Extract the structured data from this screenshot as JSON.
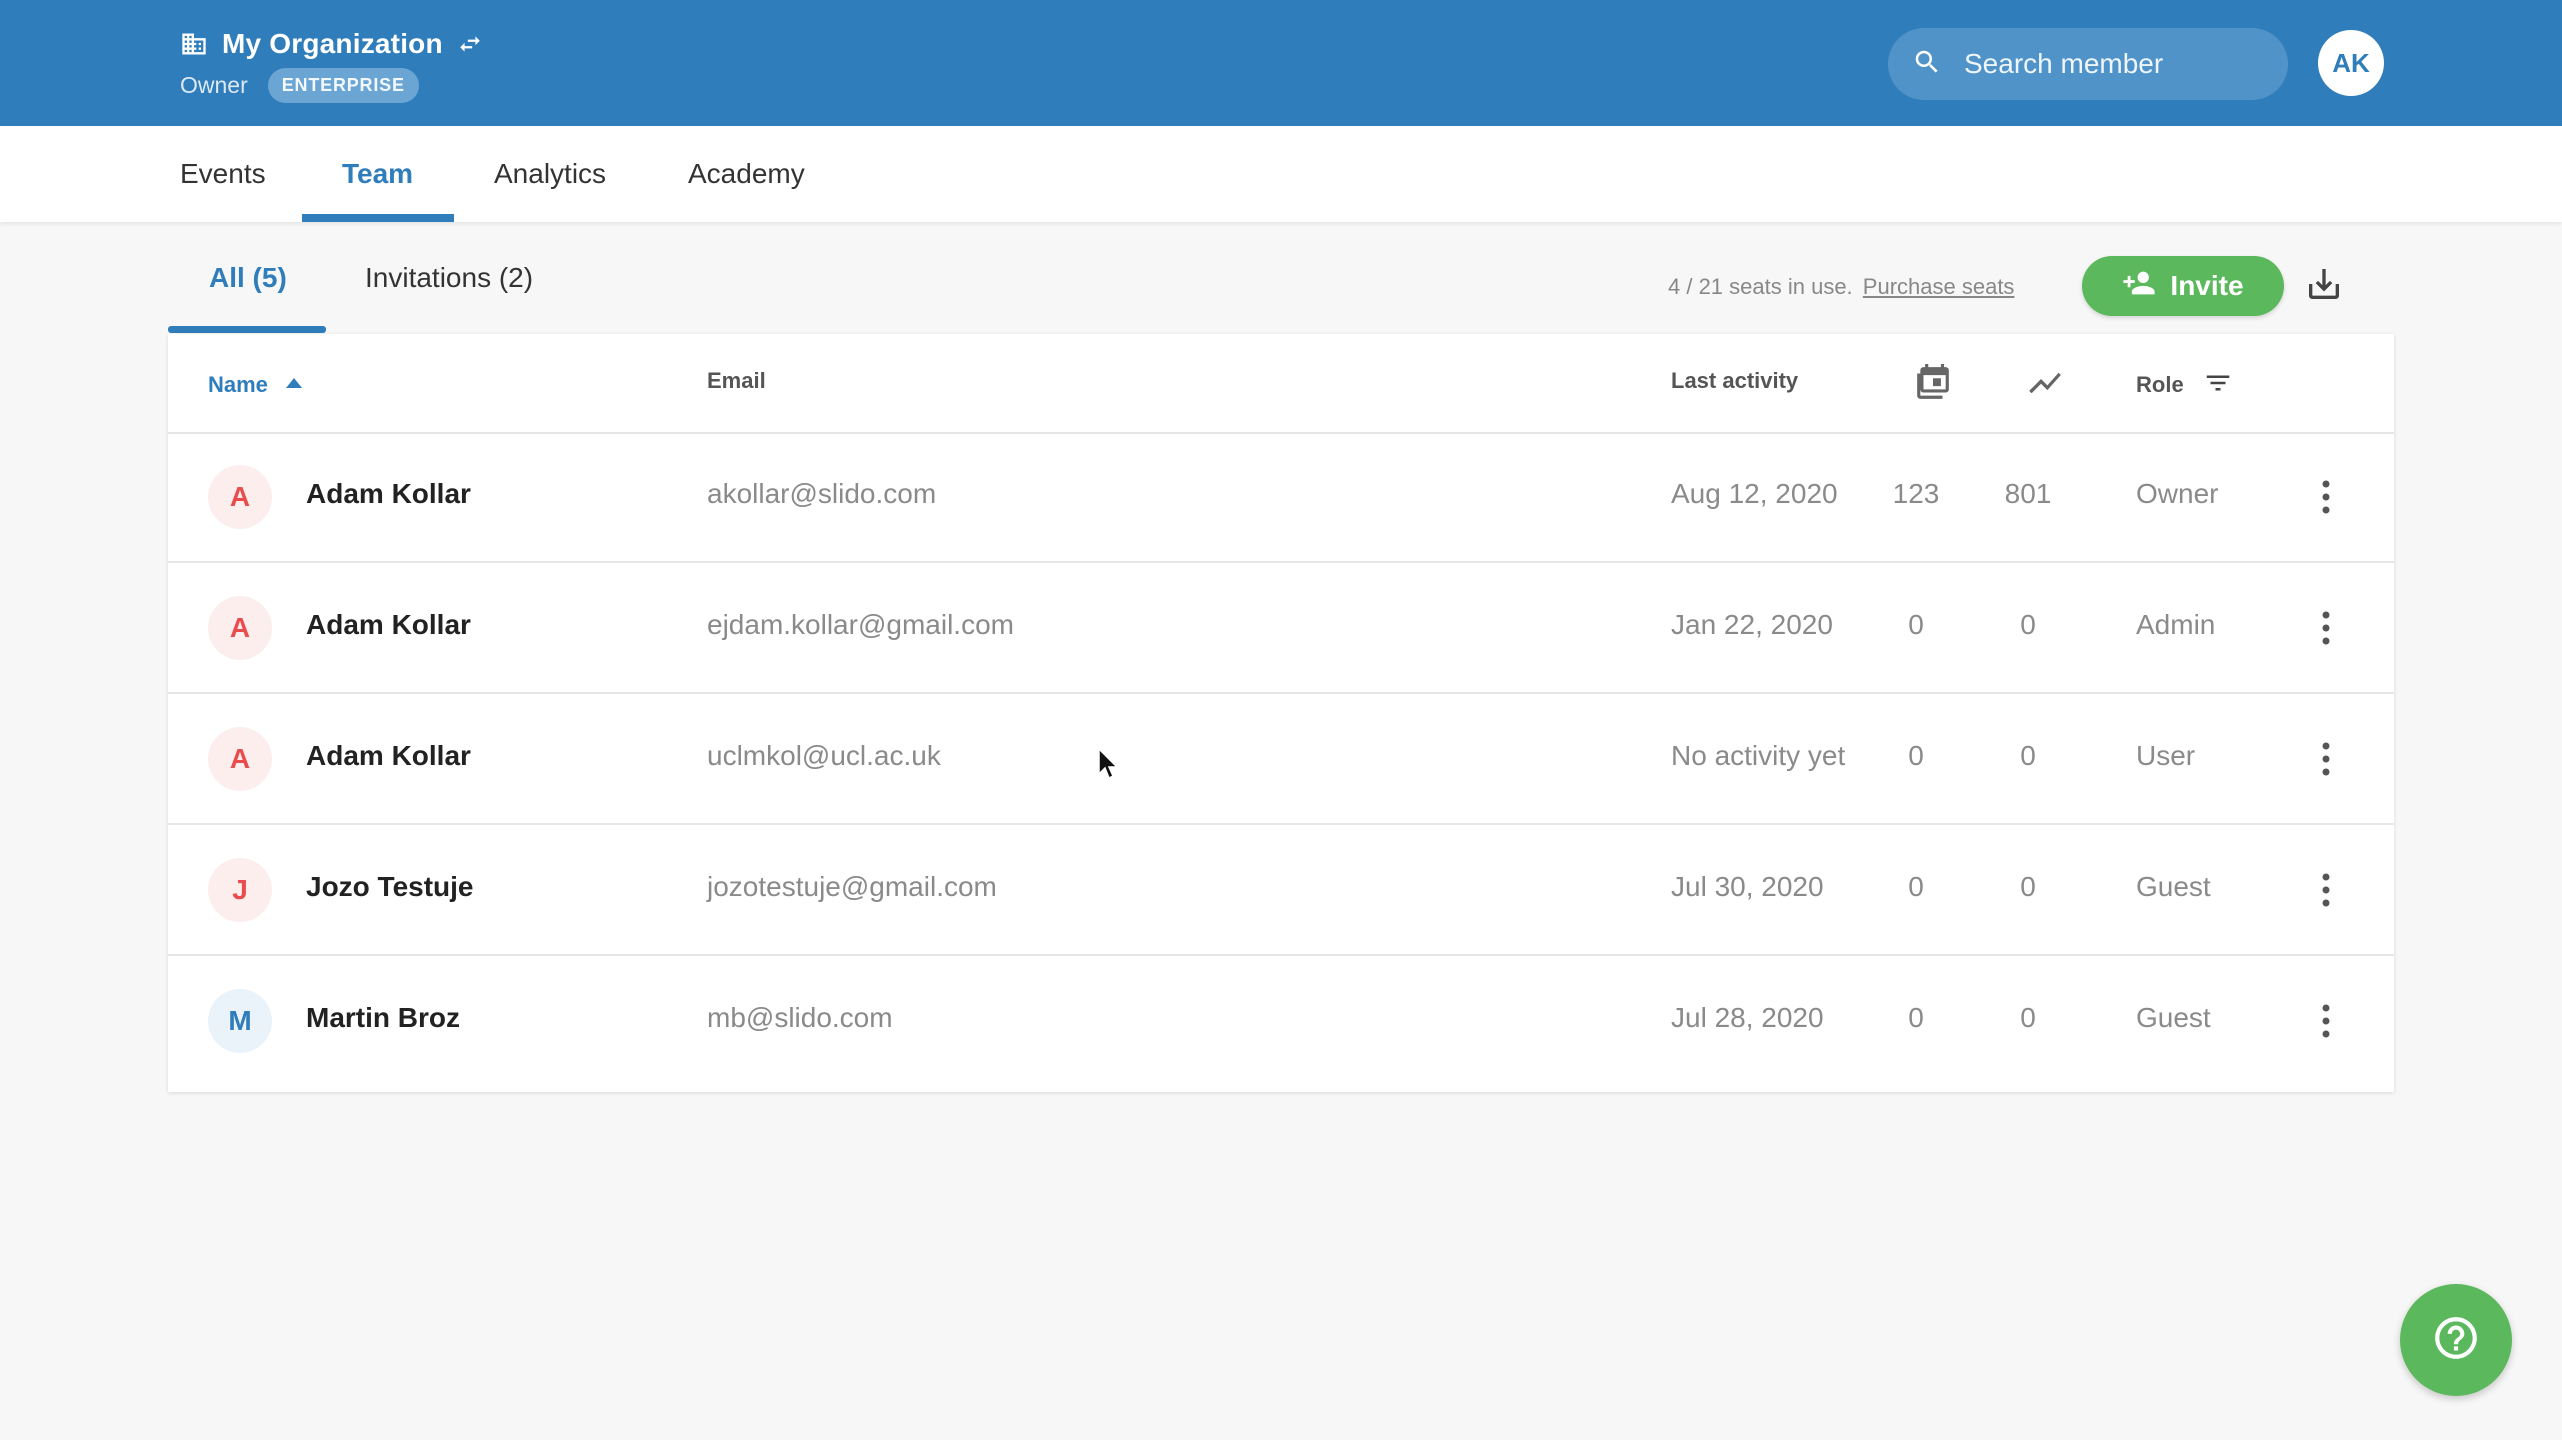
{
  "header": {
    "org_name": "My Organization",
    "role_label": "Owner",
    "plan_badge": "ENTERPRISE",
    "search_placeholder": "Search member",
    "user_initials": "AK"
  },
  "nav": {
    "tabs": [
      {
        "label": "Events"
      },
      {
        "label": "Team",
        "active": true
      },
      {
        "label": "Analytics"
      },
      {
        "label": "Academy"
      }
    ]
  },
  "team": {
    "subtabs": [
      {
        "label": "All (5)",
        "active": true
      },
      {
        "label": "Invitations (2)"
      }
    ],
    "seats_text": "4 / 21 seats in use.",
    "purchase_link": "Purchase seats",
    "invite_label": "Invite"
  },
  "table": {
    "columns": {
      "name": "Name",
      "email": "Email",
      "last_activity": "Last activity",
      "role": "Role"
    },
    "sort": {
      "column": "name",
      "direction": "asc"
    },
    "rows": [
      {
        "initial": "A",
        "name": "Adam Kollar",
        "email": "akollar@slido.com",
        "last_activity": "Aug 12, 2020",
        "events": "123",
        "analytics": "801",
        "role": "Owner"
      },
      {
        "initial": "A",
        "name": "Adam Kollar",
        "email": "ejdam.kollar@gmail.com",
        "last_activity": "Jan 22, 2020",
        "events": "0",
        "analytics": "0",
        "role": "Admin"
      },
      {
        "initial": "A",
        "name": "Adam Kollar",
        "email": "uclmkol@ucl.ac.uk",
        "last_activity": "No activity yet",
        "events": "0",
        "analytics": "0",
        "role": "User"
      },
      {
        "initial": "J",
        "name": "Jozo Testuje",
        "email": "jozotestuje@gmail.com",
        "last_activity": "Jul 30, 2020",
        "events": "0",
        "analytics": "0",
        "role": "Guest"
      },
      {
        "initial": "M",
        "name": "Martin Broz",
        "email": "mb@slido.com",
        "last_activity": "Jul 28, 2020",
        "events": "0",
        "analytics": "0",
        "role": "Guest"
      }
    ]
  },
  "icons": {
    "org": "building-icon",
    "switch": "swap-icon",
    "search": "search-icon",
    "invite": "add-person-icon",
    "download": "download-icon",
    "events_col": "calendar-icon",
    "analytics_col": "trend-icon",
    "role_filter": "filter-icon",
    "row_menu": "more-vertical-icon",
    "help": "help-icon"
  },
  "colors": {
    "header_bg": "#2f7dba",
    "accent": "#2f7dba",
    "success": "#5cb85c",
    "avatar_red_bg": "#fdeeee",
    "avatar_red_fg": "#e84c4c",
    "avatar_blue_bg": "#eaf2fa",
    "avatar_blue_fg": "#2f7dba"
  }
}
